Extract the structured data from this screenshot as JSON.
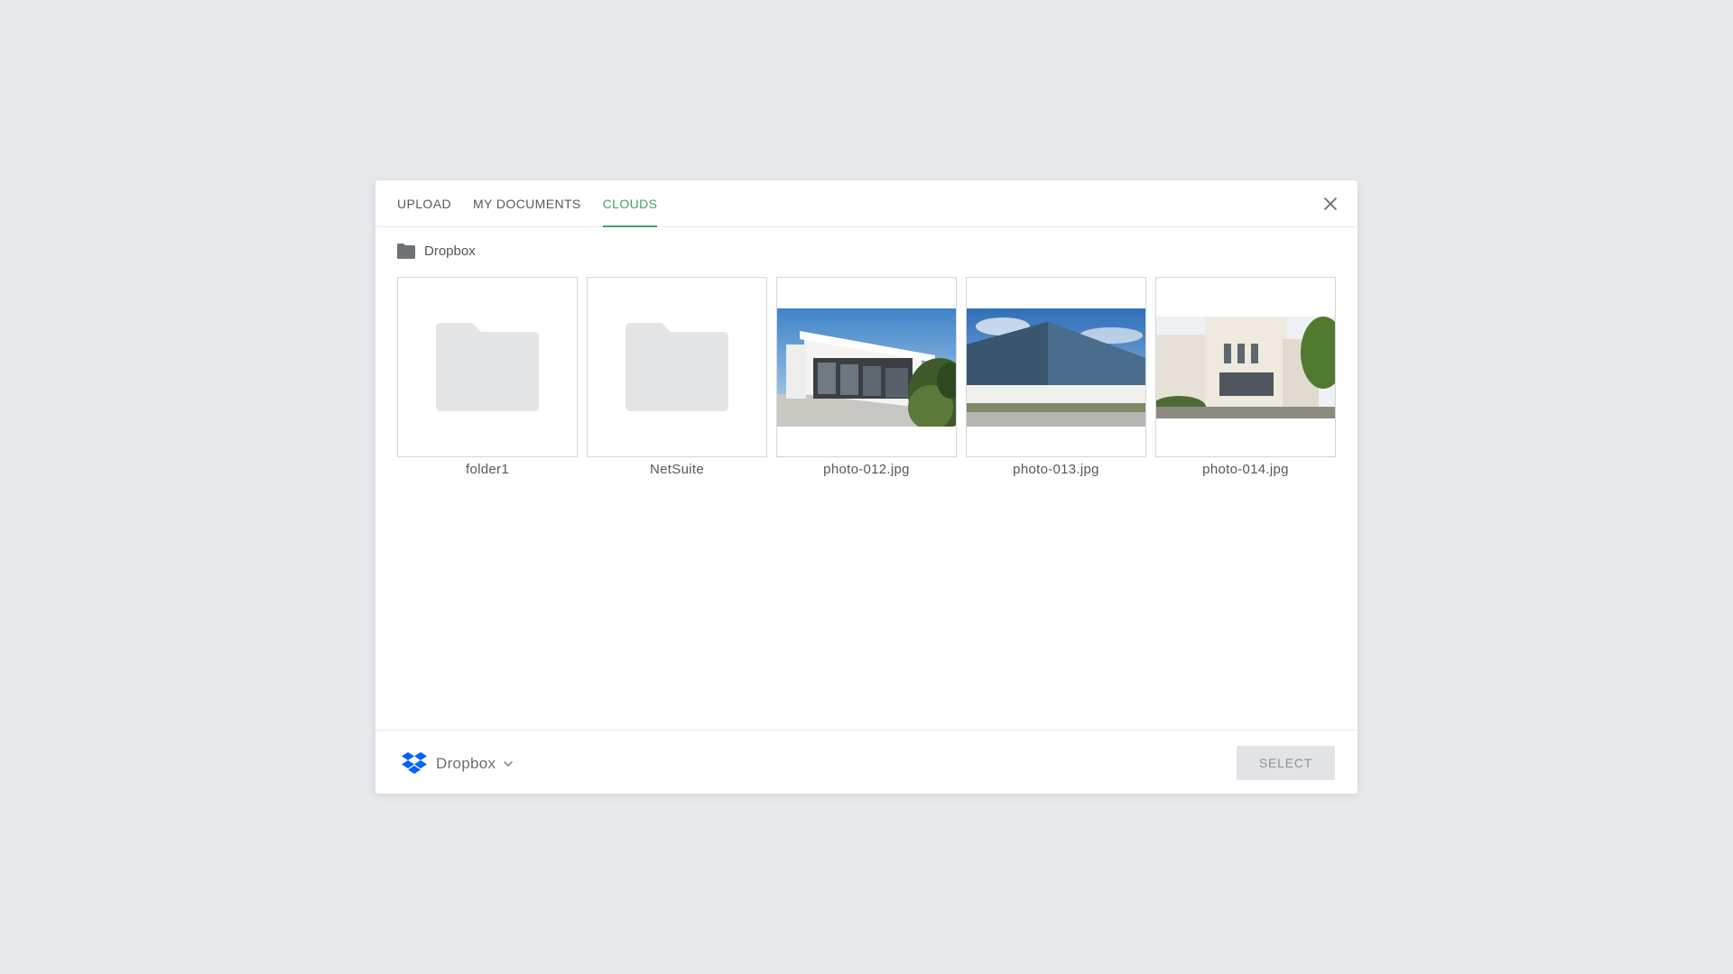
{
  "tabs": [
    {
      "label": "UPLOAD",
      "active": false
    },
    {
      "label": "MY DOCUMENTS",
      "active": false
    },
    {
      "label": "CLOUDS",
      "active": true
    }
  ],
  "breadcrumb": {
    "label": "Dropbox",
    "icon": "folder-icon"
  },
  "items": [
    {
      "name": "folder1",
      "type": "folder"
    },
    {
      "name": "NetSuite",
      "type": "folder"
    },
    {
      "name": "photo-012.jpg",
      "type": "image"
    },
    {
      "name": "photo-013.jpg",
      "type": "image"
    },
    {
      "name": "photo-014.jpg",
      "type": "image"
    }
  ],
  "footer": {
    "source_label": "Dropbox",
    "source_icon": "dropbox-icon",
    "select_label": "SELECT"
  },
  "colors": {
    "accent": "#3ca56b",
    "dropbox_blue": "#0061fe",
    "background": "#e7eaed"
  }
}
